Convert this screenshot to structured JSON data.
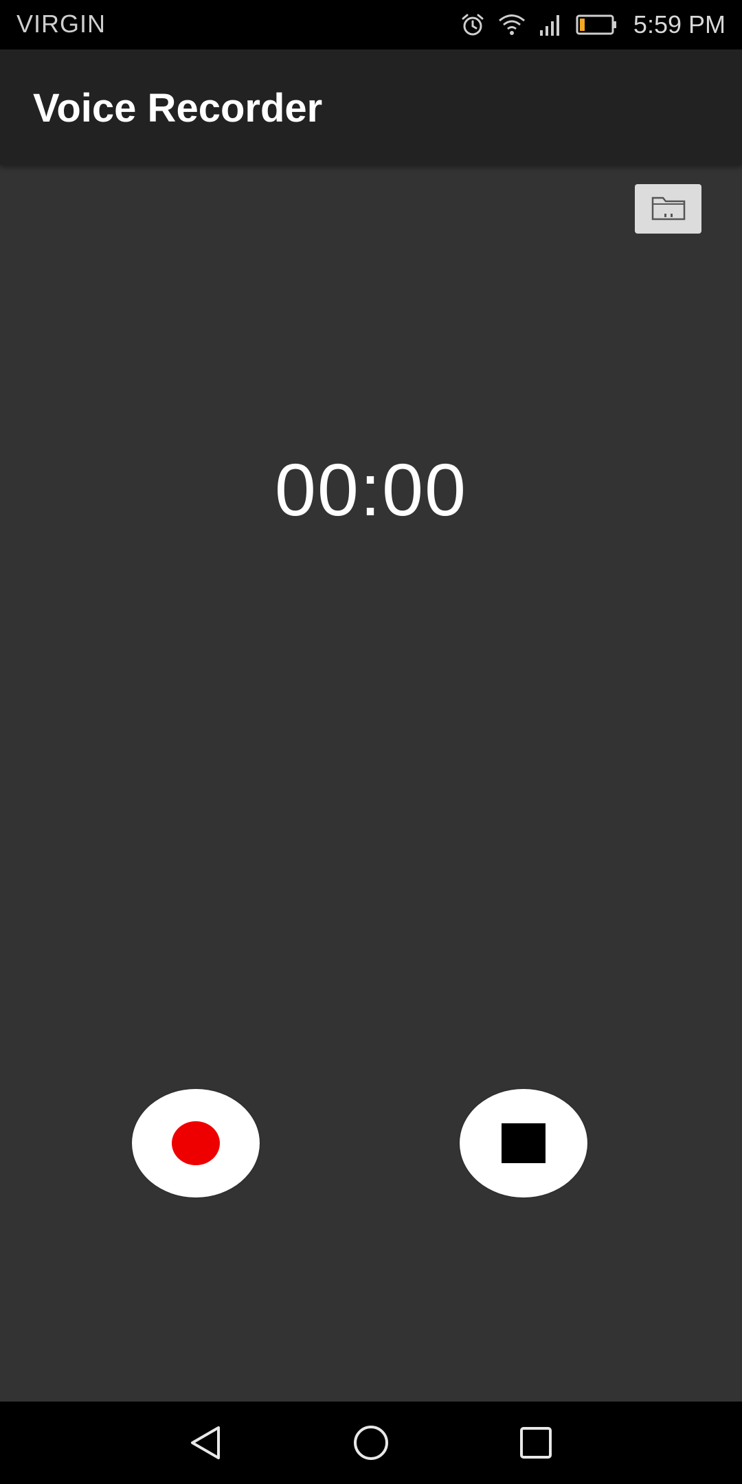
{
  "status_bar": {
    "carrier": "VIRGIN",
    "time": "5:59 PM",
    "battery_level": 0.15,
    "battery_color": "#f5a623",
    "icons": [
      "alarm-icon",
      "wifi-icon",
      "signal-icon",
      "battery-icon"
    ]
  },
  "app_bar": {
    "title": "Voice Recorder"
  },
  "main": {
    "timer": "00:00",
    "folder_icon": "folder-icon",
    "record_color": "#ee0000",
    "stop_color": "#000000"
  },
  "nav_bar": {
    "icons": [
      "back-icon",
      "home-icon",
      "recents-icon"
    ]
  }
}
